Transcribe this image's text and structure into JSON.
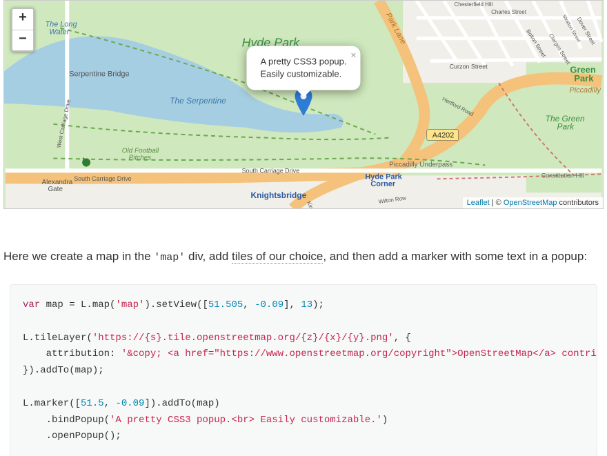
{
  "map": {
    "zoom_controls": {
      "zoom_in": "+",
      "zoom_out": "−"
    },
    "popup": {
      "line1": "A pretty CSS3 popup.",
      "line2": "Easily customizable."
    },
    "popup_close": "×",
    "attribution": {
      "leaflet": "Leaflet",
      "sep": " | © ",
      "osm": "OpenStreetMap",
      "tail": " contributors"
    },
    "labels": {
      "hyde_park": "Hyde Park",
      "serpentine": "The Serpentine",
      "serpentine_bridge": "Serpentine Bridge",
      "long_water": "The Long Water",
      "old_football": "Old Football Pitches",
      "alexandra_gate": "Alexandra Gate",
      "south_carriage_drive": "South Carriage Drive",
      "south_carriage_drive2": "South Carriage Drive",
      "knightsbridge": "Knightsbridge",
      "hyde_park_corner": "Hyde Park Corner",
      "green_park_lbl": "Green Park",
      "the_green_park": "The Green Park",
      "piccadilly": "Piccadilly",
      "piccadilly_underpass": "Piccadilly Underpass",
      "park_lane": "Park Lane",
      "curzon_street": "Curzon Street",
      "hertford_road": "Hertford Road",
      "bolton_street": "Bolton Street",
      "clarges_street": "Clarges Street",
      "charles_street": "Charles Street",
      "chesterfield_hill": "Chesterfield Hill",
      "wilton_row": "Wilton Row",
      "kinnerton": "Kinnerton",
      "constitution_hill": "Constitution Hill",
      "dover_street": "Dover Street",
      "stratton_street": "Stratton Street",
      "a4202": "A4202",
      "west_carriage_drive": "West Carriage Drive"
    }
  },
  "description": {
    "t1": "Here we create a map in the ",
    "code1": "'map'",
    "t2": " div, add ",
    "link": "tiles of our choice",
    "t3": ", and then add a marker with some text in a popup:"
  },
  "code": {
    "kw_var": "var",
    "sp1": " map = L.map(",
    "str_map": "'map'",
    "sp2": ").setView([",
    "num_lat": "51.505",
    "comma1": ", ",
    "num_lng": "-0.09",
    "sp3": "], ",
    "num_zoom": "13",
    "sp4": ");",
    "line3a": "L.tileLayer(",
    "str_tile": "'https://{s}.tile.openstreetmap.org/{z}/{x}/{y}.png'",
    "line3b": ", {",
    "line4a": "    attribution: ",
    "str_attr": "'&copy; <a href=\"https://www.openstreetmap.org/copyright\">OpenStreetMap</a> contributors'",
    "line5": "}).addTo(map);",
    "line7a": "L.marker([",
    "num_mlat": "51.5",
    "comma2": ", ",
    "num_mlng": "-0.09",
    "line7b": "]).addTo(map)",
    "line8a": "    .bindPopup(",
    "str_popup": "'A pretty CSS3 popup.<br> Easily customizable.'",
    "line8b": ")",
    "line9": "    .openPopup();"
  }
}
